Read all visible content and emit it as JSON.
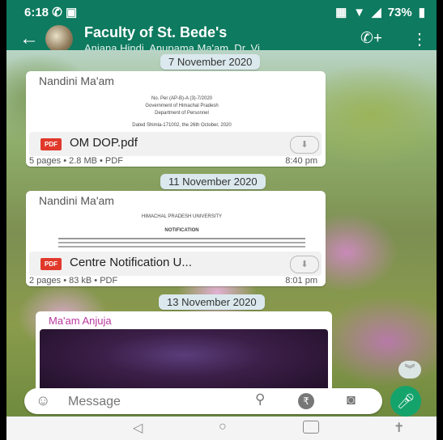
{
  "status_bar": {
    "time": "6:18",
    "battery": "73%"
  },
  "header": {
    "title": "Faculty of St. Bede's",
    "members": "Anjana Hindi, Anupama Ma'am, Dr. Vi..."
  },
  "messages": [
    {
      "date": "7 November 2020",
      "sender": "Nandini Ma'am",
      "preview_lines": [
        "No. Per (AP-B)-A (3)-7/2020",
        "Government of Himachal Pradesh",
        "Department of Personnel",
        "Dated Shimla-171002, the 26th October, 2020"
      ],
      "file_name": "OM DOP.pdf",
      "file_badge": "PDF",
      "meta": "5 pages • 2.8 MB • PDF",
      "time": "8:40 pm"
    },
    {
      "date": "11 November 2020",
      "sender": "Nandini Ma'am",
      "preview_lines": [
        "HIMACHAL PRADESH UNIVERSITY",
        "NOTIFICATION"
      ],
      "file_name": "Centre Notification U...",
      "file_badge": "PDF",
      "meta": "2 pages • 83 kB • PDF",
      "time": "8:01 pm"
    },
    {
      "date": "13 November 2020",
      "sender": "Ma'am Anjuja"
    }
  ],
  "input": {
    "placeholder": "Message"
  },
  "colors": {
    "accent": "#0e7a5f",
    "mic": "#15a36c",
    "pdf": "#e0392b",
    "sender3": "#b9379d"
  }
}
